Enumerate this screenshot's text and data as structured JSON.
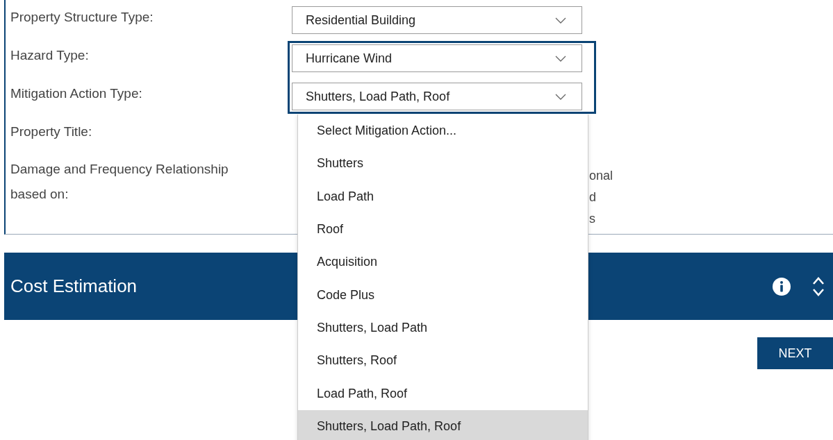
{
  "form": {
    "fields": [
      {
        "label": "Property Structure Type:",
        "kind": "select",
        "value": "Residential Building",
        "highlighted": false
      },
      {
        "label": "Hazard Type:",
        "kind": "select",
        "value": "Hurricane Wind",
        "highlighted": true
      },
      {
        "label": "Mitigation Action Type:",
        "kind": "select",
        "value": "Shutters, Load Path, Roof",
        "highlighted": true
      },
      {
        "label": "Property Title:",
        "kind": "text"
      },
      {
        "label": "Damage and Frequency Relationship based on:",
        "kind": "options",
        "options": [
          "onal",
          "d",
          "s"
        ]
      }
    ]
  },
  "dropdown": {
    "items": [
      {
        "label": "Select Mitigation Action...",
        "selected": false
      },
      {
        "label": "Shutters",
        "selected": false
      },
      {
        "label": "Load Path",
        "selected": false
      },
      {
        "label": "Roof",
        "selected": false
      },
      {
        "label": "Acquisition",
        "selected": false
      },
      {
        "label": "Code Plus",
        "selected": false
      },
      {
        "label": "Shutters, Load Path",
        "selected": false
      },
      {
        "label": "Shutters, Roof",
        "selected": false
      },
      {
        "label": "Load Path, Roof",
        "selected": false
      },
      {
        "label": "Shutters, Load Path, Roof",
        "selected": true
      }
    ]
  },
  "section": {
    "title": "Cost Estimation"
  },
  "next_button": "NEXT"
}
